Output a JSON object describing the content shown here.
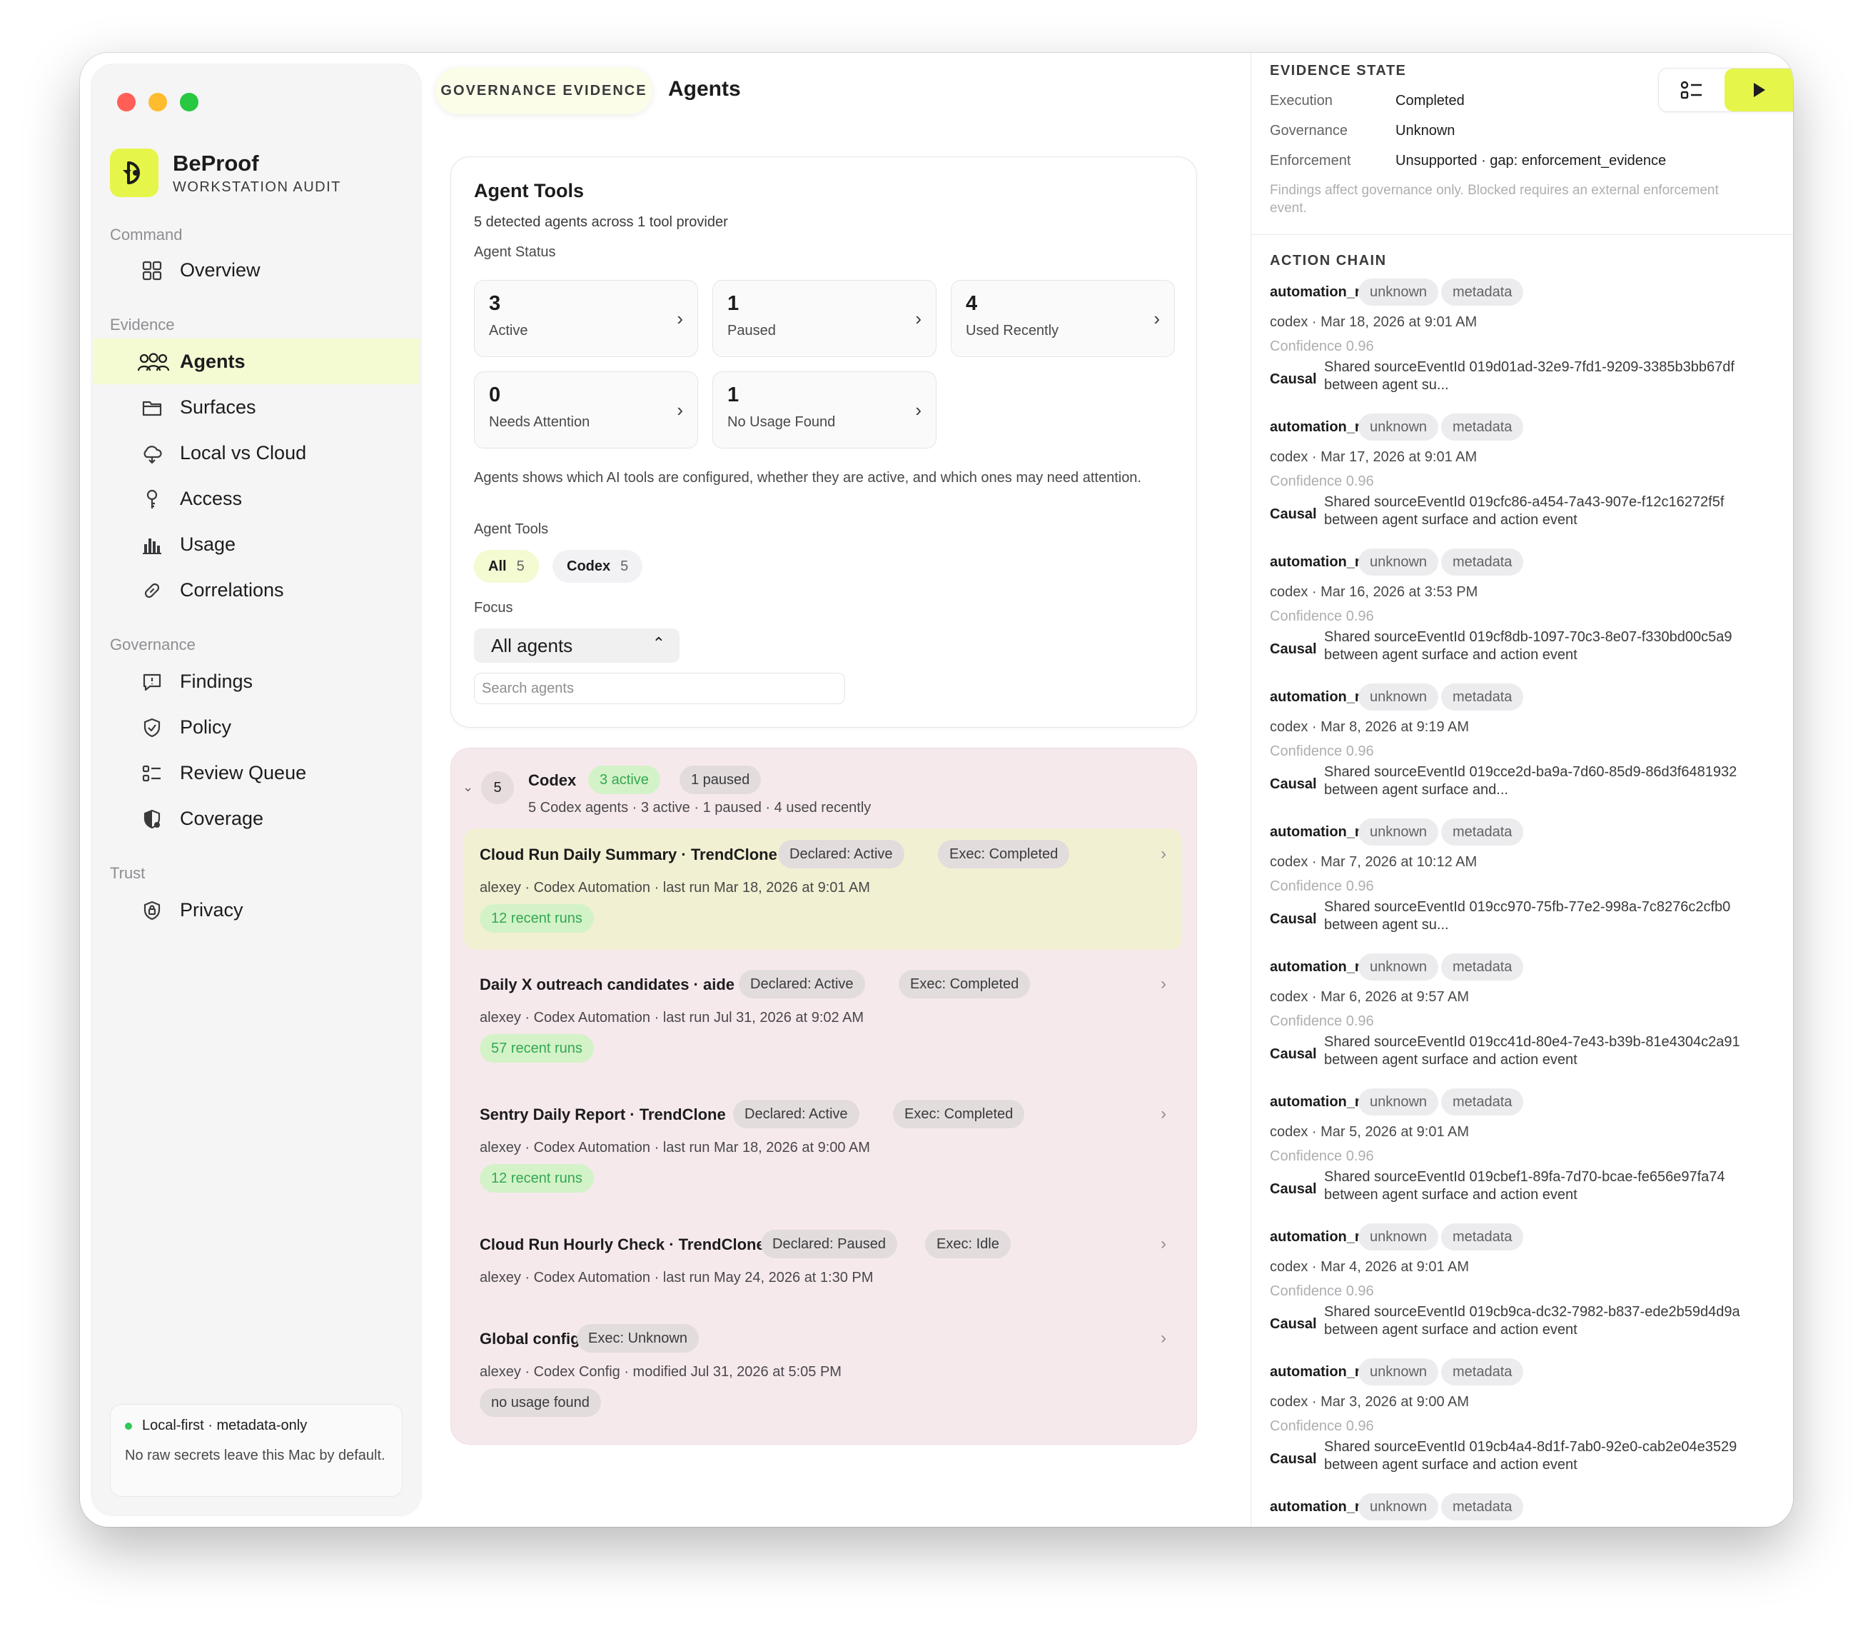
{
  "app": {
    "name": "BeProof",
    "subtitle": "WORKSTATION AUDIT"
  },
  "sidebar": {
    "sections": [
      {
        "label": "Command",
        "items": [
          {
            "label": "Overview",
            "icon": "grid-icon"
          }
        ]
      },
      {
        "label": "Evidence",
        "items": [
          {
            "label": "Agents",
            "icon": "people-icon",
            "active": true
          },
          {
            "label": "Surfaces",
            "icon": "folder-icon"
          },
          {
            "label": "Local vs Cloud",
            "icon": "cloud-icon"
          },
          {
            "label": "Access",
            "icon": "key-icon"
          },
          {
            "label": "Usage",
            "icon": "bar-chart-icon"
          },
          {
            "label": "Correlations",
            "icon": "link-icon"
          }
        ]
      },
      {
        "label": "Governance",
        "items": [
          {
            "label": "Findings",
            "icon": "message-alert-icon"
          },
          {
            "label": "Policy",
            "icon": "shield-check-icon"
          },
          {
            "label": "Review Queue",
            "icon": "checklist-icon"
          },
          {
            "label": "Coverage",
            "icon": "shield-half-icon"
          }
        ]
      },
      {
        "label": "Trust",
        "items": [
          {
            "label": "Privacy",
            "icon": "lock-shield-icon"
          }
        ]
      }
    ],
    "footer": {
      "line1": "Local-first · metadata-only",
      "line2": "No raw secrets leave this Mac by default."
    }
  },
  "header": {
    "breadcrumb": "GOVERNANCE EVIDENCE",
    "title": "Agents"
  },
  "agent_tools": {
    "title": "Agent Tools",
    "subtitle": "5 detected agents across 1 tool provider",
    "status_label": "Agent Status",
    "stats": [
      {
        "value": "3",
        "label": "Active"
      },
      {
        "value": "1",
        "label": "Paused"
      },
      {
        "value": "4",
        "label": "Used Recently"
      },
      {
        "value": "0",
        "label": "Needs Attention"
      },
      {
        "value": "1",
        "label": "No Usage Found"
      }
    ],
    "description": "Agents shows which AI tools are configured, whether they are active, and which ones may need attention.",
    "tools_label": "Agent Tools",
    "filters": [
      {
        "label": "All",
        "count": "5",
        "selected": true
      },
      {
        "label": "Codex",
        "count": "5",
        "selected": false
      }
    ],
    "focus_label": "Focus",
    "focus_value": "All agents",
    "search_placeholder": "Search agents"
  },
  "group": {
    "count": "5",
    "name": "Codex",
    "badges": [
      "3 active",
      "1 paused"
    ],
    "summary": "5 Codex agents · 3 active · 1 paused · 4 used recently",
    "agents": [
      {
        "name": "Cloud Run Daily Summary · TrendClone",
        "tags": [
          "Declared: Active",
          "Exec: Completed"
        ],
        "meta": "alexey · Codex Automation · last run Mar 18, 2026 at 9:01 AM",
        "runs": "12 recent runs",
        "runs_style": "green",
        "selected": true
      },
      {
        "name": "Daily X outreach candidates · aide",
        "tags": [
          "Declared: Active",
          "Exec: Completed"
        ],
        "meta": "alexey · Codex Automation · last run Jul 31, 2026 at 9:02 AM",
        "runs": "57 recent runs",
        "runs_style": "green",
        "selected": false
      },
      {
        "name": "Sentry Daily Report · TrendClone",
        "tags": [
          "Declared: Active",
          "Exec: Completed"
        ],
        "meta": "alexey · Codex Automation · last run Mar 18, 2026 at 9:00 AM",
        "runs": "12 recent runs",
        "runs_style": "green",
        "selected": false
      },
      {
        "name": "Cloud Run Hourly Check · TrendClone",
        "tags": [
          "Declared: Paused",
          "Exec: Idle"
        ],
        "meta": "alexey · Codex Automation · last run May 24, 2026 at 1:30 PM",
        "runs": "",
        "runs_style": "",
        "selected": false
      },
      {
        "name": "Global config",
        "tags": [
          "Exec: Unknown"
        ],
        "meta": "alexey · Codex Config · modified Jul 31, 2026 at 5:05 PM",
        "runs": "no usage found",
        "runs_style": "gray",
        "selected": false
      }
    ]
  },
  "evidence_state": {
    "heading": "EVIDENCE STATE",
    "rows": [
      {
        "key": "Execution",
        "value": "Completed"
      },
      {
        "key": "Governance",
        "value": "Unknown"
      },
      {
        "key": "Enforcement",
        "value": "Unsupported · gap: enforcement_evidence"
      }
    ],
    "note": "Findings affect governance only. Blocked requires an external enforcement event."
  },
  "action_chain": {
    "heading": "ACTION CHAIN",
    "causal_label": "Causal",
    "events": [
      {
        "name": "automation_run",
        "tags": [
          "unknown",
          "metadata"
        ],
        "line": "codex · Mar 18, 2026 at 9:01 AM",
        "confidence": "Confidence 0.96",
        "causal": "Shared sourceEventId 019d01ad-32e9-7fd1-9209-3385b3bb67df between agent su..."
      },
      {
        "name": "automation_run",
        "tags": [
          "unknown",
          "metadata"
        ],
        "line": "codex · Mar 17, 2026 at 9:01 AM",
        "confidence": "Confidence 0.96",
        "causal": "Shared sourceEventId 019cfc86-a454-7a43-907e-f12c16272f5f between agent surface and action event"
      },
      {
        "name": "automation_run",
        "tags": [
          "unknown",
          "metadata"
        ],
        "line": "codex · Mar 16, 2026 at 3:53 PM",
        "confidence": "Confidence 0.96",
        "causal": "Shared sourceEventId 019cf8db-1097-70c3-8e07-f330bd00c5a9 between agent surface and action event"
      },
      {
        "name": "automation_run",
        "tags": [
          "unknown",
          "metadata"
        ],
        "line": "codex · Mar 8, 2026 at 9:19 AM",
        "confidence": "Confidence 0.96",
        "causal": "Shared sourceEventId 019cce2d-ba9a-7d60-85d9-86d3f6481932 between agent surface and..."
      },
      {
        "name": "automation_run",
        "tags": [
          "unknown",
          "metadata"
        ],
        "line": "codex · Mar 7, 2026 at 10:12 AM",
        "confidence": "Confidence 0.96",
        "causal": "Shared sourceEventId 019cc970-75fb-77e2-998a-7c8276c2cfb0 between agent su..."
      },
      {
        "name": "automation_run",
        "tags": [
          "unknown",
          "metadata"
        ],
        "line": "codex · Mar 6, 2026 at 9:57 AM",
        "confidence": "Confidence 0.96",
        "causal": "Shared sourceEventId 019cc41d-80e4-7e43-b39b-81e4304c2a91 between agent surface and action event"
      },
      {
        "name": "automation_run",
        "tags": [
          "unknown",
          "metadata"
        ],
        "line": "codex · Mar 5, 2026 at 9:01 AM",
        "confidence": "Confidence 0.96",
        "causal": "Shared sourceEventId 019cbef1-89fa-7d70-bcae-fe656e97fa74 between agent surface and action event"
      },
      {
        "name": "automation_run",
        "tags": [
          "unknown",
          "metadata"
        ],
        "line": "codex · Mar 4, 2026 at 9:01 AM",
        "confidence": "Confidence 0.96",
        "causal": "Shared sourceEventId 019cb9ca-dc32-7982-b837-ede2b59d4d9a between agent surface and action event"
      },
      {
        "name": "automation_run",
        "tags": [
          "unknown",
          "metadata"
        ],
        "line": "codex · Mar 3, 2026 at 9:00 AM",
        "confidence": "Confidence 0.96",
        "causal": "Shared sourceEventId 019cb4a4-8d1f-7ab0-92e0-cab2e04e3529 between agent surface and action event"
      },
      {
        "name": "automation_run",
        "tags": [
          "unknown",
          "metadata"
        ],
        "line": "",
        "confidence": "",
        "causal": ""
      }
    ]
  },
  "colors": {
    "accent": "#e6f54a",
    "active_nav": "#f4fad2",
    "group_bg": "#f6e9ec",
    "selected_row": "#f2f0d2",
    "success": "#34a853"
  }
}
